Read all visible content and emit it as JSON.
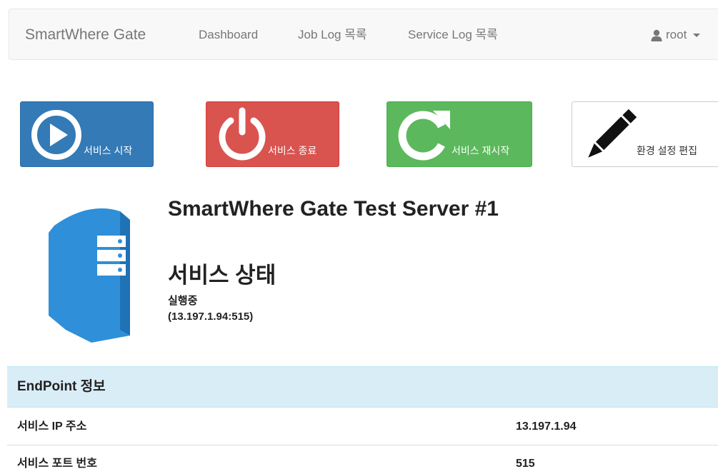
{
  "navbar": {
    "brand": "SmartWhere Gate",
    "links": {
      "dashboard": "Dashboard",
      "job_log": "Job Log 목록",
      "service_log": "Service Log 목록"
    },
    "user": {
      "name": "root",
      "icon": "user-icon"
    }
  },
  "actions": {
    "start": {
      "label": "서비스 시작",
      "icon": "play-circle-icon",
      "color": "#337ab7"
    },
    "stop": {
      "label": "서비스 종료",
      "icon": "power-icon",
      "color": "#d9534f"
    },
    "restart": {
      "label": "서비스 재시작",
      "icon": "refresh-icon",
      "color": "#5cb85c"
    },
    "config": {
      "label": "환경 설정 편집",
      "icon": "pencil-icon",
      "color": "#ffffff"
    }
  },
  "server": {
    "icon": "server-icon",
    "name": "SmartWhere Gate Test Server #1",
    "status_heading": "서비스 상태",
    "status": "실행중",
    "endpoint": "(13.197.1.94:515)"
  },
  "endpoint_panel": {
    "title": "EndPoint 정보",
    "rows": [
      {
        "label": "서비스 IP 주소",
        "value": "13.197.1.94"
      },
      {
        "label": "서비스 포트 번호",
        "value": "515"
      }
    ]
  }
}
